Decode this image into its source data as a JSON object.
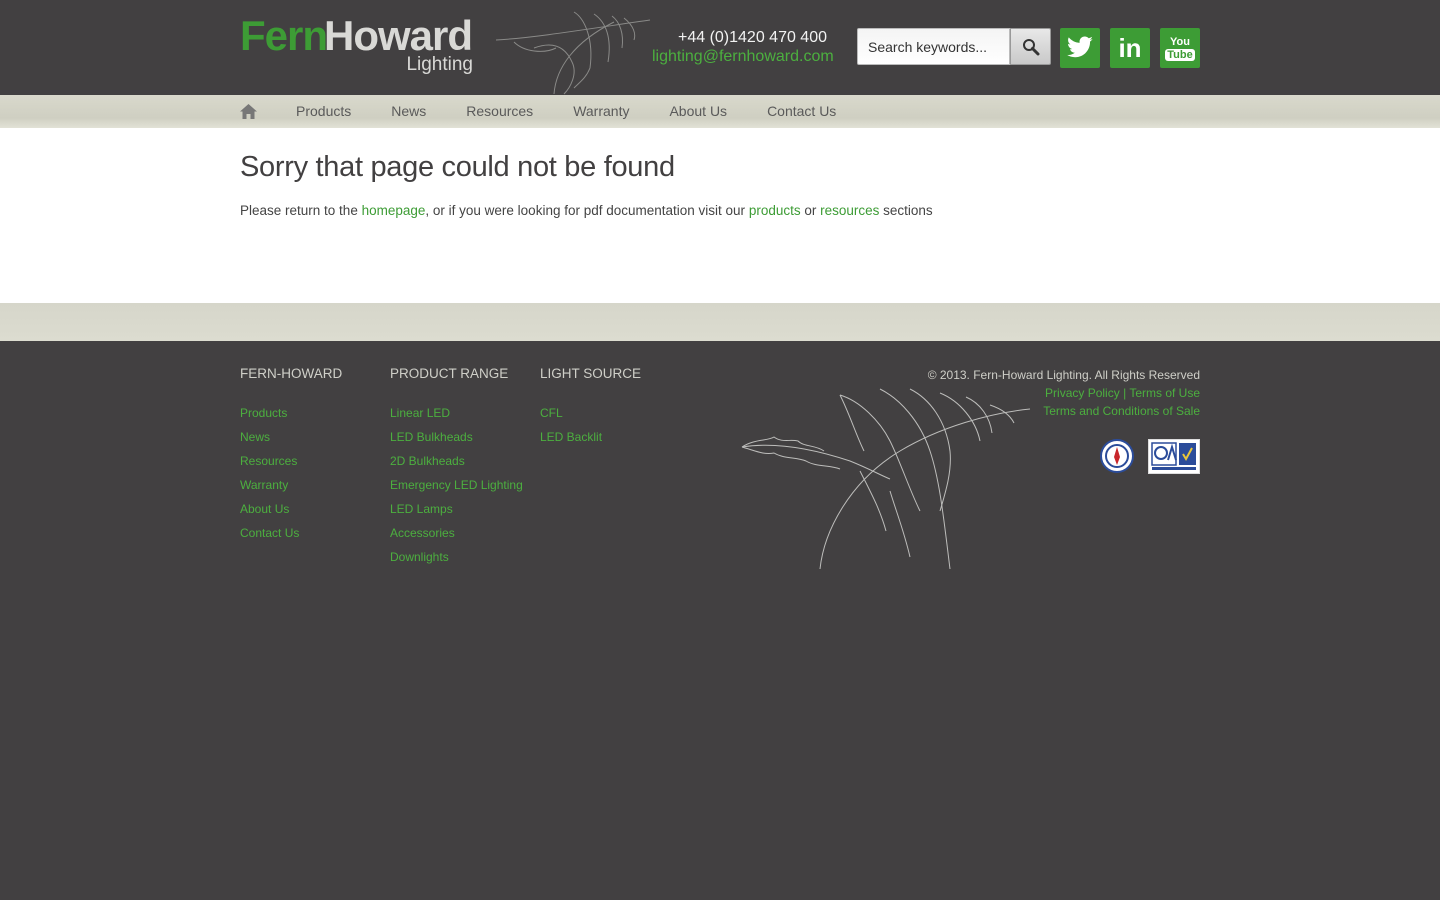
{
  "header": {
    "logo": {
      "fern": "Fern",
      "howard": "Howard",
      "lighting": "Lighting"
    },
    "phone": "+44 (0)1420 470 400",
    "email": "lighting@fernhoward.com",
    "search": {
      "placeholder": "Search keywords...",
      "button_icon": "magnifier-icon"
    },
    "social": [
      {
        "name": "twitter",
        "icon": "twitter-bird-icon"
      },
      {
        "name": "linkedin",
        "label": "in"
      },
      {
        "name": "youtube",
        "label_top": "You",
        "label_bottom": "Tube"
      }
    ]
  },
  "nav": {
    "home_icon": "home-icon",
    "items": [
      "Products",
      "News",
      "Resources",
      "Warranty",
      "About Us",
      "Contact Us"
    ]
  },
  "main": {
    "title": "Sorry that page could not be found",
    "text_1": "Please return to the ",
    "link_home": "homepage",
    "text_2": ", or if you were looking for pdf documentation visit our ",
    "link_products": "products",
    "text_3": " or ",
    "link_resources": "resources",
    "text_4": " sections"
  },
  "footer": {
    "col1": {
      "heading": "FERN-HOWARD",
      "links": [
        "Products",
        "News",
        "Resources",
        "Warranty",
        "About Us",
        "Contact Us"
      ]
    },
    "col2": {
      "heading": "PRODUCT RANGE",
      "links": [
        "Linear LED",
        "LED Bulkheads",
        "2D Bulkheads",
        "Emergency LED Lighting",
        "LED Lamps",
        "Accessories",
        "Downlights"
      ]
    },
    "col3": {
      "heading": "LIGHT SOURCE",
      "links": [
        "CFL",
        "LED Backlit"
      ]
    },
    "copyright": "© 2013. Fern-Howard Lighting. All Rights Reserved",
    "privacy": "Privacy Policy",
    "separator": "|",
    "terms_use": "Terms of Use",
    "terms_sale": "Terms and Conditions of Sale"
  },
  "colors": {
    "brand_green": "#3d9c35",
    "dark_bg": "#424041",
    "nav_bg": "#d6d6ca"
  }
}
